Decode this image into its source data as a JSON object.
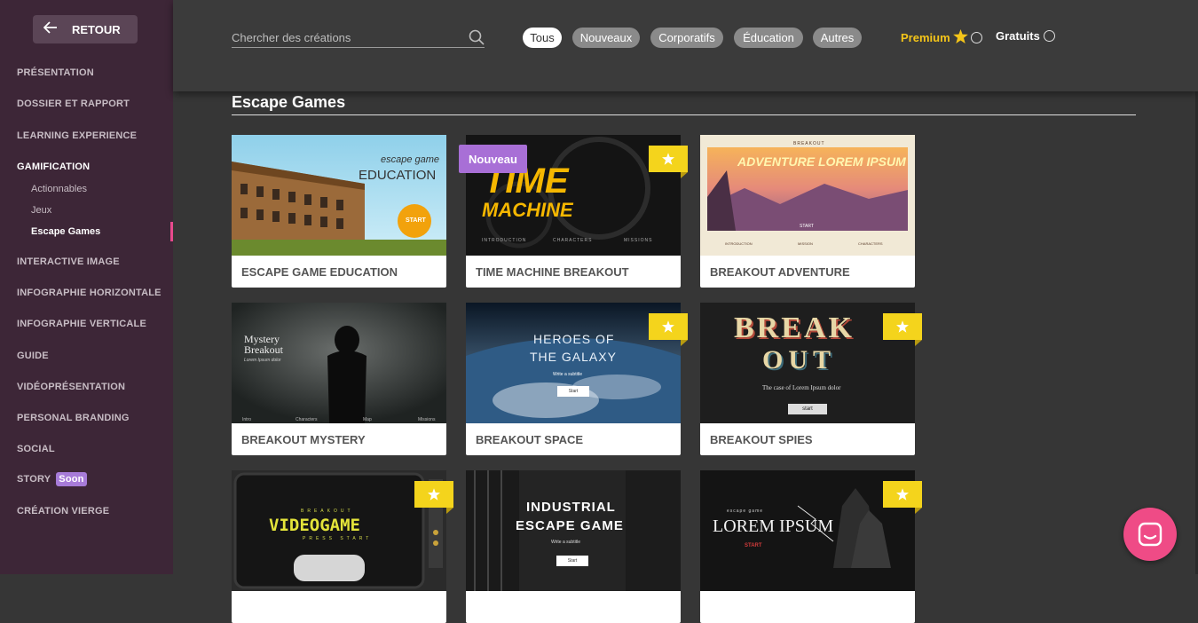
{
  "sidebar": {
    "back_label": "RETOUR",
    "items": [
      {
        "label": "PRÉSENTATION"
      },
      {
        "label": "DOSSIER ET RAPPORT"
      },
      {
        "label": "LEARNING EXPERIENCE"
      },
      {
        "label": "GAMIFICATION"
      },
      {
        "label": "INTERACTIVE IMAGE"
      },
      {
        "label": "INFOGRAPHIE HORIZONTALE"
      },
      {
        "label": "INFOGRAPHIE VERTICALE"
      },
      {
        "label": "GUIDE"
      },
      {
        "label": "VIDÉOPRÉSENTATION"
      },
      {
        "label": "PERSONAL BRANDING"
      },
      {
        "label": "SOCIAL"
      },
      {
        "label": "STORY",
        "badge": "Soon"
      },
      {
        "label": "CRÉATION VIERGE"
      }
    ],
    "subitems": [
      {
        "label": "Actionnables"
      },
      {
        "label": "Jeux"
      },
      {
        "label": "Escape Games"
      }
    ]
  },
  "topbar": {
    "search_placeholder": "Chercher des créations",
    "filters": [
      "Tous",
      "Nouveaux",
      "Corporatifs",
      "Éducation",
      "Autres"
    ],
    "premium_label": "Premium",
    "free_label": "Gratuits"
  },
  "section": {
    "title": "Escape Games"
  },
  "cards": [
    {
      "label": "ESCAPE GAME EDUCATION",
      "thumb": {
        "line1": "escape game",
        "line2": "EDUCATION",
        "cta": "START"
      }
    },
    {
      "label": "TIME MACHINE BREAKOUT",
      "badge_new": "Nouveau",
      "thumb": {
        "line1": "TIME",
        "line2": "MACHINE",
        "nav": [
          "INTRODUCTION",
          "CHARACTERS",
          "MISSIONS"
        ]
      }
    },
    {
      "label": "BREAKOUT ADVENTURE",
      "thumb": {
        "kicker": "BREAKOUT",
        "title": "ADVENTURE LOREM IPSUM",
        "cta": "START",
        "nav": [
          "INTRODUCTION",
          "MISSION",
          "CHARACTERS"
        ]
      }
    },
    {
      "label": "BREAKOUT MYSTERY",
      "thumb": {
        "line1": "Mystery",
        "line2": "Breakout",
        "sub": "Lorem Ipsum dolor",
        "nav": [
          "Intro",
          "Characters",
          "Map",
          "Missions"
        ]
      }
    },
    {
      "label": "BREAKOUT SPACE",
      "thumb": {
        "line1": "HEROES OF",
        "line2": "THE GALAXY",
        "sub": "Write a subtitle",
        "cta": "Start"
      }
    },
    {
      "label": "BREAKOUT SPIES",
      "thumb": {
        "line1": "BREAK",
        "line2": "OUT",
        "sub": "The case of Lorem Ipsum dolor",
        "cta": "start"
      }
    },
    {
      "label": "",
      "thumb": {
        "kicker": "BREAKOUT",
        "title": "VIDEOGAME",
        "sub": "PRESS START"
      }
    },
    {
      "label": "",
      "thumb": {
        "line1": "INDUSTRIAL",
        "line2": "ESCAPE GAME",
        "sub": "Write a subtitle",
        "cta": "Start"
      }
    },
    {
      "label": "",
      "thumb": {
        "kicker": "escape game",
        "title": "LOREM IPSUM",
        "cta": "START"
      }
    }
  ],
  "colors": {
    "accent": "#e64a8c",
    "premium": "#f4d41c",
    "new": "#a86fd6",
    "sidebar": "#3d2637"
  }
}
